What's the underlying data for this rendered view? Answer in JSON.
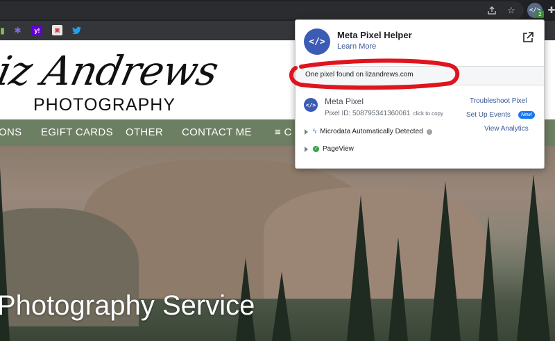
{
  "popup": {
    "title": "Meta Pixel Helper",
    "learn_more": "Learn More",
    "found_message": "One pixel found on lizandrews.com",
    "pixel": {
      "name": "Meta Pixel",
      "id_text": "Pixel ID: 508795341360061",
      "copy_hint": "click to copy"
    },
    "links": {
      "troubleshoot": "Troubleshoot Pixel",
      "setup_events": "Set Up Events",
      "new_badge": "New!",
      "view_analytics": "View Analytics"
    },
    "events": [
      {
        "label": "Microdata Automatically Detected",
        "icon": "lightning-icon"
      },
      {
        "label": "PageView",
        "icon": "check-circle-icon"
      }
    ],
    "logo_glyph": "</>"
  },
  "browser": {
    "extension_count": "2"
  },
  "website": {
    "logo_script": "Liz Andrews",
    "logo_subtitle": "PHOTOGRAPHY",
    "nav": [
      "ONS",
      "EGIFT CARDS",
      "OTHER",
      "CONTACT ME",
      "≡ C"
    ],
    "hero_heading": "Photography Service"
  },
  "colors": {
    "nav_bg": "#6d7f62",
    "meta_blue": "#3b5bb5",
    "link_blue": "#385898",
    "annotation_red": "#e0141e"
  }
}
